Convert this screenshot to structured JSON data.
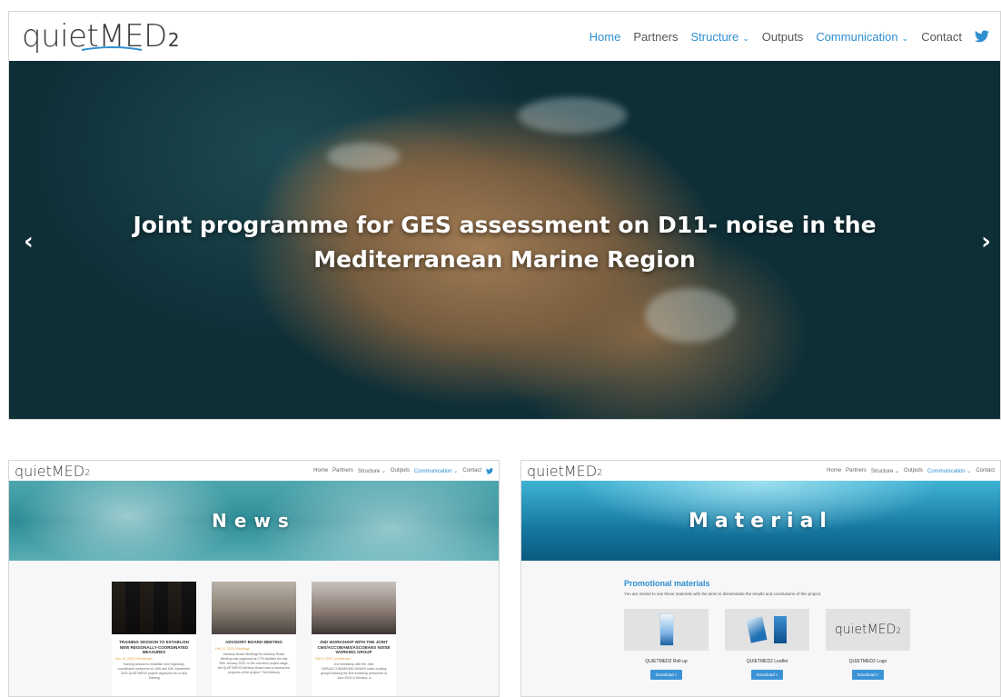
{
  "site": {
    "logo_main": "quietMED",
    "logo_sub": "2",
    "nav": [
      {
        "label": "Home",
        "state": "active",
        "dropdown": false
      },
      {
        "label": "Partners",
        "state": "",
        "dropdown": false
      },
      {
        "label": "Structure",
        "state": "accent",
        "dropdown": true
      },
      {
        "label": "Outputs",
        "state": "",
        "dropdown": false
      },
      {
        "label": "Communication",
        "state": "accent",
        "dropdown": true
      },
      {
        "label": "Contact",
        "state": "",
        "dropdown": false
      }
    ],
    "social_icon": "twitter-icon",
    "accent_color": "#2e8fd0"
  },
  "hero": {
    "title": "Joint programme for GES assessment on D11- noise in the Mediterranean Marine Region",
    "prev_icon": "chevron-left-icon",
    "next_icon": "chevron-right-icon"
  },
  "news_page": {
    "logo_main": "quietMED",
    "logo_sub": "2",
    "nav": [
      "Home",
      "Partners",
      "Structure ⌄",
      "Outputs",
      "Communication ⌄",
      "Contact"
    ],
    "banner": "News",
    "cards": [
      {
        "title": "TRAINING SESSION TO ESTABLISH NEW REGIONALLY-COORDINATED MEASURES",
        "meta": "Nov 10, 2020 | Workshops",
        "text": "Training session to establish new regionally-coordinated measures on 10th and 11th September 2020 QUIETMED2 project organized an on-line Training"
      },
      {
        "title": "ADVISORY BOARD MEETING",
        "meta": "Feb 12, 2020 | Meetings",
        "text": "Advisory Board MeetingThe Advisory Board Meeting was organised at CTN facilities the last 30th January 2020. In the mid-term project stage, the QUIETMED2 Advisory Board was to assess the progress of the project. The Advisory"
      },
      {
        "title": "2ND WORKSHOP WITH THE JOINT CMS/ACCOBAMS/ASCOBANS NOISE WORKING GROUP",
        "meta": "Feb 5, 2020 | Workshops",
        "text": "2nd Workshop with the Joint CMS/ACCOBAMS/ASCOBANS noise working groupFollowing the first workshop performed in June 2019 in Monaco, a"
      }
    ]
  },
  "material_page": {
    "logo_main": "quietMED",
    "logo_sub": "2",
    "nav": [
      "Home",
      "Partners",
      "Structure ⌄",
      "Outputs",
      "Communication ⌄",
      "Contact"
    ],
    "banner": "Material",
    "heading": "Promotional materials",
    "intro": "You are invited to use these materials with the aims to disseminate the results and conclusions of this project.",
    "items": [
      {
        "name": "QUIETMED2 Roll-up",
        "button": "Download »"
      },
      {
        "name": "QUIETMED2 Leaflet",
        "button": "Download »"
      },
      {
        "name": "QUIETMED2 Logo",
        "button": "Download »"
      }
    ]
  }
}
